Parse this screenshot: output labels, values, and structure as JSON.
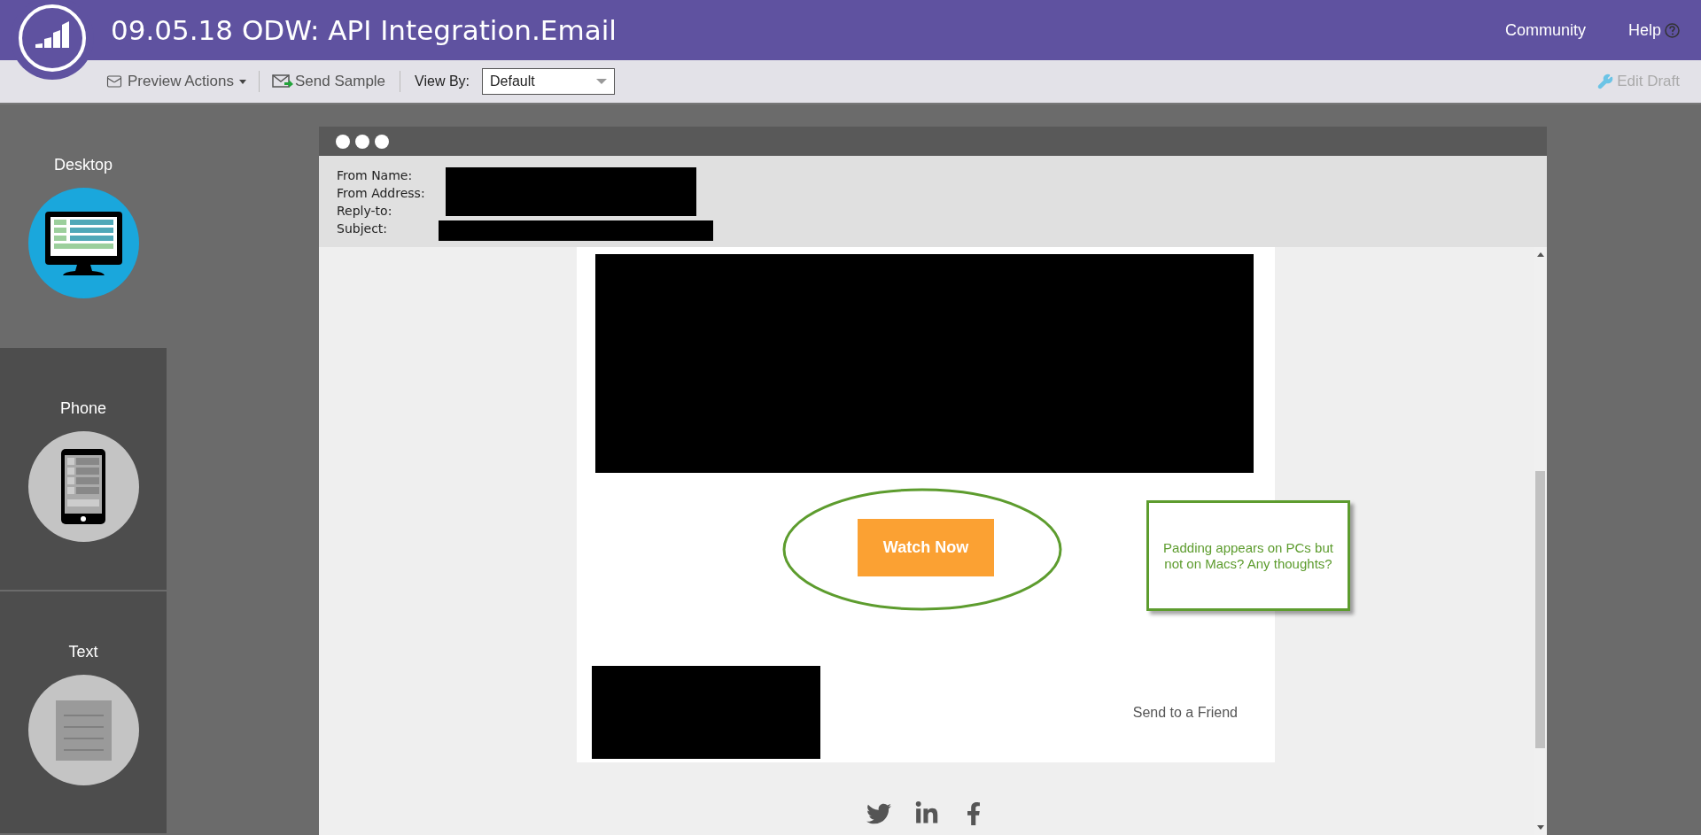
{
  "header": {
    "title": "09.05.18 ODW: API Integration.Email",
    "links": [
      "Community",
      "Help"
    ]
  },
  "toolbar": {
    "preview_actions": "Preview Actions",
    "send_sample": "Send Sample",
    "view_by_label": "View By:",
    "view_by_value": "Default",
    "edit_draft": {
      "label": "Edit Draft",
      "disabled": true
    }
  },
  "sidebar": {
    "items": [
      {
        "label": "Desktop",
        "kind": "desktop",
        "selected": true
      },
      {
        "label": "Phone",
        "kind": "phone",
        "selected": false
      },
      {
        "label": "Text",
        "kind": "text",
        "selected": false
      }
    ]
  },
  "preview": {
    "header_fields": [
      {
        "label": "From Name:"
      },
      {
        "label": "From Address:"
      },
      {
        "label": "Reply-to:"
      },
      {
        "label": "Subject:"
      }
    ],
    "cta_button": "Watch Now",
    "send_to_friend": "Send to a Friend",
    "annotation": "Padding appears on PCs but not on Macs? Any thoughts?"
  }
}
